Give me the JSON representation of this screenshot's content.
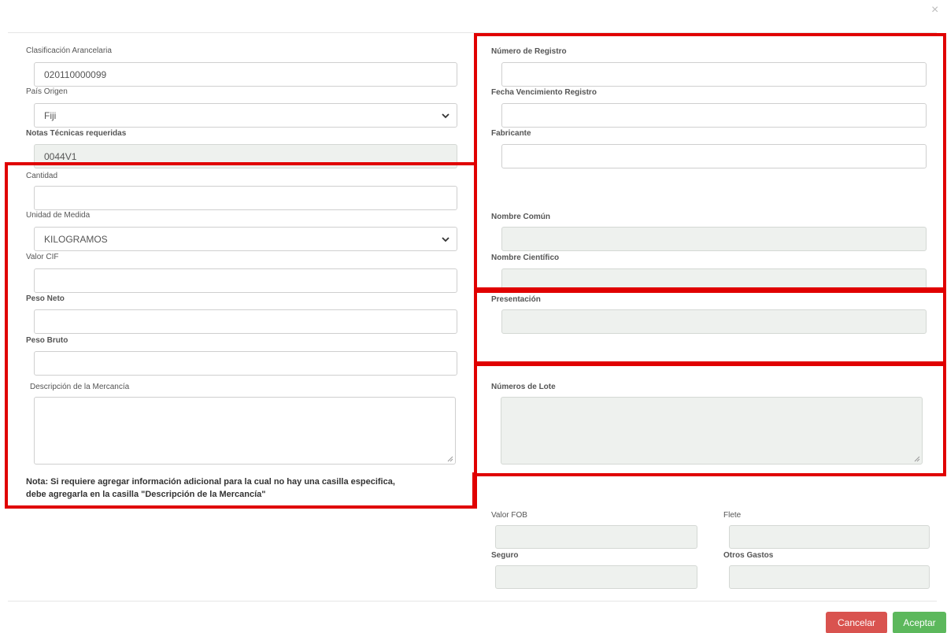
{
  "modal": {
    "close_glyph": "×",
    "left": {
      "clasificacion": {
        "label": "Clasificación Arancelaria",
        "value": "020110000099"
      },
      "pais_origen": {
        "label": "País Origen",
        "value": "Fiji"
      },
      "notas_tecnicas": {
        "label": "Notas Técnicas requeridas",
        "value": "0044V1"
      },
      "cantidad": {
        "label": "Cantidad",
        "value": ""
      },
      "unidad_medida": {
        "label": "Unidad de Medida",
        "value": "KILOGRAMOS"
      },
      "valor_cif": {
        "label": "Valor CIF",
        "value": ""
      },
      "peso_neto": {
        "label": "Peso Neto",
        "value": ""
      },
      "peso_bruto": {
        "label": "Peso Bruto",
        "value": ""
      },
      "descripcion": {
        "label": "Descripción de la Mercancía",
        "value": ""
      },
      "note_line1": "Nota: Si requiere agregar información adicional para la cual no hay una casilla especifica,",
      "note_line2": "debe agregarla en la casilla \"Descripción de la Mercancía\""
    },
    "right": {
      "numero_registro": {
        "label": "Número de Registro",
        "value": ""
      },
      "fecha_vencimiento": {
        "label": "Fecha Vencimiento Registro",
        "value": ""
      },
      "fabricante": {
        "label": "Fabricante",
        "value": ""
      },
      "nombre_comun": {
        "label": "Nombre Común",
        "value": ""
      },
      "nombre_cientifico": {
        "label": "Nombre Científico",
        "value": ""
      },
      "presentacion": {
        "label": "Presentación",
        "value": ""
      },
      "numeros_lote": {
        "label": "Números de Lote",
        "value": ""
      },
      "valor_fob": {
        "label": "Valor FOB",
        "value": ""
      },
      "flete": {
        "label": "Flete",
        "value": ""
      },
      "seguro": {
        "label": "Seguro",
        "value": ""
      },
      "otros_gastos": {
        "label": "Otros Gastos",
        "value": ""
      }
    },
    "footer": {
      "cancel_label": "Cancelar",
      "accept_label": "Aceptar"
    }
  },
  "colors": {
    "highlight_red": "#e00000",
    "cancel": "#d9534f",
    "accept": "#5cb85c",
    "readonly_bg": "#eef1ee"
  }
}
